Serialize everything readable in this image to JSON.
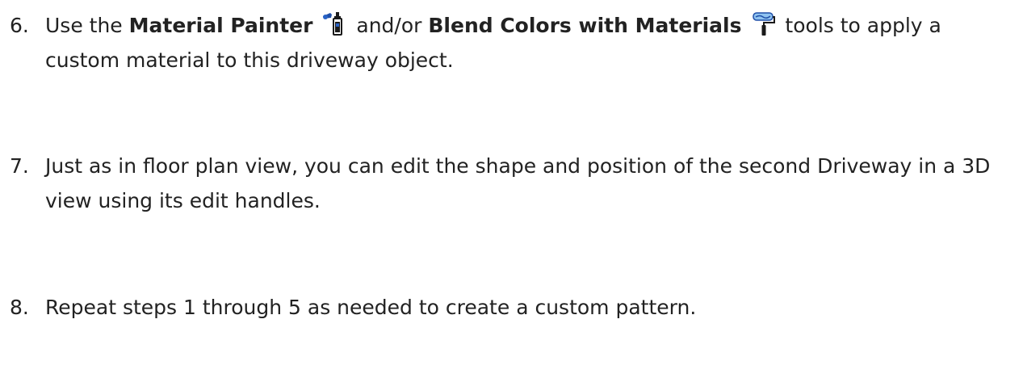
{
  "steps": [
    {
      "number": "6.",
      "text_before": "Use the ",
      "tool1_name": "Material Painter",
      "tool1_icon": "material-painter-icon",
      "text_between": " and/or ",
      "tool2_name": "Blend Colors with Materials",
      "tool2_icon": "blend-colors-with-materials-icon",
      "text_after": " tools to apply a custom material to this driveway object."
    },
    {
      "number": "7.",
      "text": "Just as in floor plan view, you can edit the shape and position of the second Driveway in a 3D view using its edit handles."
    },
    {
      "number": "8.",
      "text": "Repeat steps 1 through 5 as needed to create a custom pattern."
    }
  ],
  "colors": {
    "text": "#222222",
    "icon_blue": "#1f4fa8",
    "icon_light_blue": "#8fc3f0",
    "icon_dark": "#1a1a1a"
  }
}
